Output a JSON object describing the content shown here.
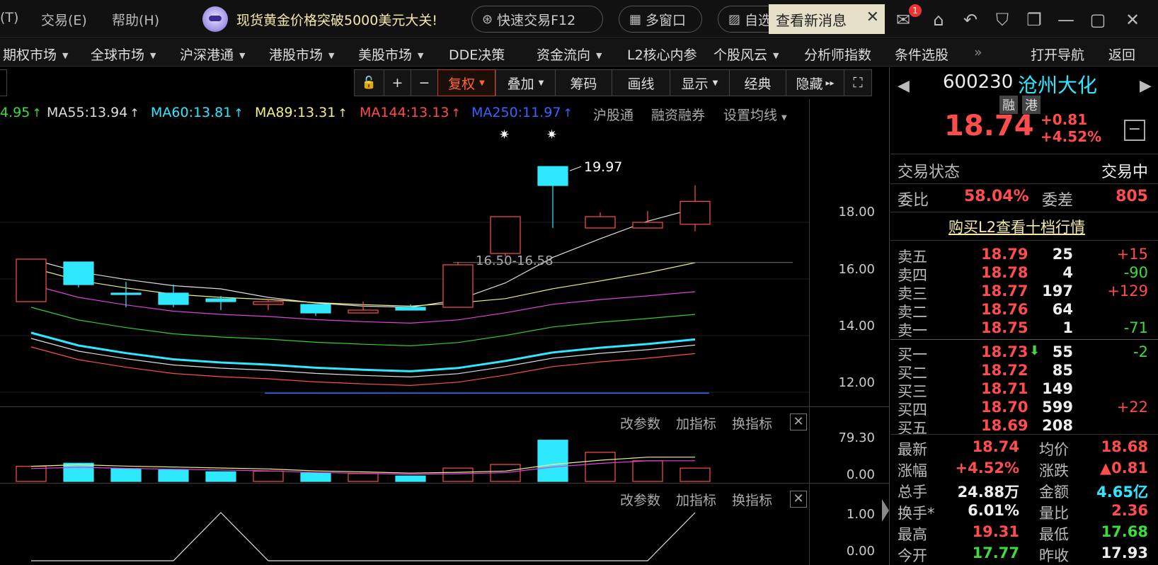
{
  "menu": {
    "item1": "(T)",
    "item2": "交易(E)",
    "item3": "帮助(H)"
  },
  "news": {
    "text": "现货黄金价格突破5000美元大关!"
  },
  "toolbar_pills": {
    "fast_trade": "快速交易F12",
    "multi_window": "多窗口",
    "custom": "自选"
  },
  "message_popup": {
    "text": "查看新消息",
    "close": "✕"
  },
  "mail_badge": "1",
  "nav": {
    "items": [
      "期权市场",
      "全球市场",
      "沪深港通",
      "港股市场",
      "美股市场",
      "DDE决策",
      "资金流向",
      "L2核心内参",
      "个股风云",
      "分析师指数",
      "条件选股"
    ],
    "more": "»",
    "open_nav": "打开导航",
    "back": "返回"
  },
  "chart_toolbar": {
    "lock": "🔓",
    "plus": "+",
    "minus": "−",
    "restore": "复权",
    "overlay": "叠加",
    "chips": "筹码",
    "draw": "画线",
    "display": "显示",
    "classic": "经典",
    "hide": "隐藏",
    "hide_arrow": "▸▸",
    "fullscreen": "⛶"
  },
  "ma_legend": [
    {
      "label": "4.95",
      "arrow": "↑",
      "color": "#3ddb3d"
    },
    {
      "label": "MA55:13.94",
      "arrow": "↑",
      "color": "#dddddd"
    },
    {
      "label": "MA60:13.81",
      "arrow": "↑",
      "color": "#2ee8ff"
    },
    {
      "label": "MA89:13.31",
      "arrow": "↑",
      "color": "#f0f080"
    },
    {
      "label": "MA144:13.13",
      "arrow": "↑",
      "color": "#ff4d4d"
    },
    {
      "label": "MA250:11.97",
      "arrow": "↑",
      "color": "#3366ff"
    }
  ],
  "legend_links": {
    "hgt": "沪股通",
    "margin": "融资融券",
    "set_ma": "设置均线"
  },
  "price_annotations": {
    "high": "19.97",
    "range": "16.50-16.58"
  },
  "price_axis": [
    "18.00",
    "16.00",
    "14.00",
    "12.00"
  ],
  "indicator1": {
    "change_params": "改参数",
    "add": "加指标",
    "switch": "换指标",
    "close": "✕",
    "axis_top": "79.30",
    "axis_bottom": "0.00"
  },
  "indicator2": {
    "change_params": "改参数",
    "add": "加指标",
    "switch": "换指标",
    "close": "✕",
    "axis_top": "1.00",
    "axis_bottom": "0.00"
  },
  "chart_data": {
    "type": "candlestick",
    "candles": [
      {
        "open": 15.2,
        "close": 16.7,
        "high": 16.7,
        "low": 15.2
      },
      {
        "open": 16.6,
        "close": 15.8,
        "high": 16.6,
        "low": 15.7
      },
      {
        "open": 15.5,
        "close": 15.45,
        "high": 15.9,
        "low": 15.0
      },
      {
        "open": 15.5,
        "close": 15.1,
        "high": 15.8,
        "low": 15.0
      },
      {
        "open": 15.3,
        "close": 15.2,
        "high": 15.4,
        "low": 14.9
      },
      {
        "open": 15.1,
        "close": 15.2,
        "high": 15.3,
        "low": 14.9
      },
      {
        "open": 15.1,
        "close": 14.8,
        "high": 15.1,
        "low": 14.7
      },
      {
        "open": 14.8,
        "close": 14.9,
        "high": 15.2,
        "low": 14.8
      },
      {
        "open": 15.0,
        "close": 14.9,
        "high": 15.1,
        "low": 14.9
      },
      {
        "open": 15.0,
        "close": 16.5,
        "high": 16.6,
        "low": 15.0
      },
      {
        "open": 16.9,
        "close": 18.2,
        "high": 18.2,
        "low": 16.8
      },
      {
        "open": 19.97,
        "close": 19.3,
        "high": 19.97,
        "low": 17.8
      },
      {
        "open": 17.8,
        "close": 18.2,
        "high": 18.35,
        "low": 17.8
      },
      {
        "open": 17.8,
        "close": 18.0,
        "high": 18.4,
        "low": 17.8
      },
      {
        "open": 17.93,
        "close": 18.74,
        "high": 19.31,
        "low": 17.68
      }
    ],
    "volume_max": 79.3,
    "volumes": [
      25,
      30,
      21,
      19,
      16,
      17,
      14,
      13,
      9,
      22,
      28,
      68,
      48,
      34,
      22
    ],
    "indicator2": [
      0,
      0,
      0,
      0,
      1,
      0,
      0,
      0,
      0,
      0,
      0,
      0,
      0,
      0,
      1
    ],
    "y_range": [
      11.5,
      20.5
    ]
  },
  "stock": {
    "code": "600230",
    "name": "沧州大化",
    "tag1": "融",
    "tag2": "港",
    "price": "18.74",
    "change": "+0.81",
    "change_pct": "+4.52%",
    "minus_btn": "−",
    "prev_arrow": "◀",
    "next_arrow": "▶"
  },
  "trade_status": {
    "label": "交易状态",
    "value": "交易中"
  },
  "commission": {
    "ratio_label": "委比",
    "ratio_value": "58.04%",
    "diff_label": "委差",
    "diff_value": "805"
  },
  "l2_link": "购买L2查看十档行情",
  "orderbook": {
    "asks": [
      {
        "label": "卖五",
        "price": "18.79",
        "vol": "25",
        "chg": "+15",
        "chg_color": "#ff4d4d"
      },
      {
        "label": "卖四",
        "price": "18.78",
        "vol": "4",
        "chg": "-90",
        "chg_color": "#3ddb3d"
      },
      {
        "label": "卖三",
        "price": "18.77",
        "vol": "197",
        "chg": "+129",
        "chg_color": "#ff4d4d"
      },
      {
        "label": "卖二",
        "price": "18.76",
        "vol": "64",
        "chg": "",
        "chg_color": "#ff4d4d"
      },
      {
        "label": "卖一",
        "price": "18.75",
        "vol": "1",
        "chg": "-71",
        "chg_color": "#3ddb3d"
      }
    ],
    "bids": [
      {
        "label": "买一",
        "price": "18.73",
        "vol": "55",
        "chg": "-2",
        "chg_color": "#3ddb3d",
        "arrow": "⬇"
      },
      {
        "label": "买二",
        "price": "18.72",
        "vol": "85",
        "chg": "",
        "chg_color": "#ff4d4d",
        "arrow": ""
      },
      {
        "label": "买三",
        "price": "18.71",
        "vol": "149",
        "chg": "",
        "chg_color": "#ff4d4d",
        "arrow": ""
      },
      {
        "label": "买四",
        "price": "18.70",
        "vol": "599",
        "chg": "+22",
        "chg_color": "#ff4d4d",
        "arrow": ""
      },
      {
        "label": "买五",
        "price": "18.69",
        "vol": "208",
        "chg": "",
        "chg_color": "#ff4d4d",
        "arrow": ""
      }
    ]
  },
  "stats": [
    {
      "l1": "最新",
      "v1": "18.74",
      "c1": "#ff4d4d",
      "l2": "均价",
      "v2": "18.68",
      "c2": "#ff4d4d"
    },
    {
      "l1": "涨幅",
      "v1": "+4.52%",
      "c1": "#ff4d4d",
      "l2": "涨跌",
      "v2": "▲0.81",
      "c2": "#ff4d4d"
    },
    {
      "l1": "总手",
      "v1": "24.88万",
      "c1": "#eeeeee",
      "l2": "金额",
      "v2": "4.65亿",
      "c2": "#2ee8ff"
    },
    {
      "l1": "换手*",
      "v1": "6.01%",
      "c1": "#eeeeee",
      "l2": "量比",
      "v2": "2.36",
      "c2": "#ff4d4d"
    },
    {
      "l1": "最高",
      "v1": "19.31",
      "c1": "#ff4d4d",
      "l2": "最低",
      "v2": "17.68",
      "c2": "#3ddb3d"
    },
    {
      "l1": "今开",
      "v1": "17.77",
      "c1": "#3ddb3d",
      "l2": "昨收",
      "v2": "17.93",
      "c2": "#eeeeee"
    }
  ]
}
